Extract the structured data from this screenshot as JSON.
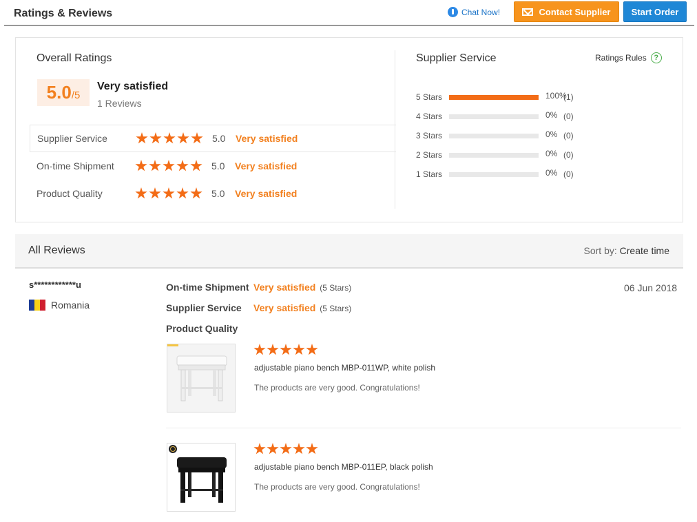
{
  "header": {
    "title": "Ratings & Reviews",
    "chat_label": "Chat Now!",
    "contact_label": "Contact Supplier",
    "start_label": "Start Order"
  },
  "overall": {
    "title": "Overall Ratings",
    "score": "5.0",
    "out_of": "/5",
    "label": "Very satisfied",
    "count": "1 Reviews",
    "rows": [
      {
        "label": "Supplier Service",
        "stars": 5,
        "score": "5.0",
        "desc": "Very satisfied"
      },
      {
        "label": "On-time Shipment",
        "stars": 5,
        "score": "5.0",
        "desc": "Very satisfied"
      },
      {
        "label": "Product Quality",
        "stars": 5,
        "score": "5.0",
        "desc": "Very satisfied"
      }
    ]
  },
  "supplier_service": {
    "title": "Supplier Service",
    "rules_label": "Ratings Rules",
    "distribution": [
      {
        "label": "5 Stars",
        "pct": "100%",
        "count": "(1)",
        "fraction": 1.0
      },
      {
        "label": "4 Stars",
        "pct": "0%",
        "count": "(0)",
        "fraction": 0
      },
      {
        "label": "3 Stars",
        "pct": "0%",
        "count": "(0)",
        "fraction": 0
      },
      {
        "label": "2 Stars",
        "pct": "0%",
        "count": "(0)",
        "fraction": 0
      },
      {
        "label": "1 Stars",
        "pct": "0%",
        "count": "(0)",
        "fraction": 0
      }
    ]
  },
  "all_reviews": {
    "title": "All Reviews",
    "sort_prefix": "Sort by: ",
    "sort_value": "Create time"
  },
  "review": {
    "reviewer": "s************u",
    "country": "Romania",
    "date": "06 Jun 2018",
    "lines": [
      {
        "key": "On-time Shipment",
        "value": "Very satisfied",
        "stars_text": "(5 Stars)"
      },
      {
        "key": "Supplier Service",
        "value": "Very satisfied",
        "stars_text": "(5 Stars)"
      },
      {
        "key": "Product Quality",
        "value": "",
        "stars_text": ""
      }
    ],
    "products": [
      {
        "name": "adjustable piano bench MBP-011WP, white polish",
        "comment": "The products are very good. Congratulations!",
        "stars": 5
      },
      {
        "name": "adjustable piano bench MBP-011EP, black polish",
        "comment": "The products are very good. Congratulations!",
        "stars": 5
      }
    ]
  },
  "colors": {
    "accent": "#f36c16",
    "blue": "#1f87d6",
    "orange_button": "#f7941d"
  }
}
